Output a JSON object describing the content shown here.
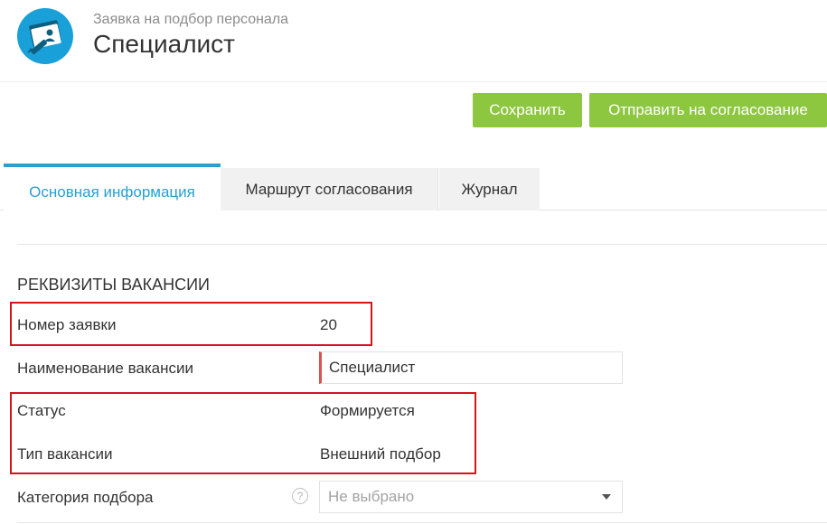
{
  "header": {
    "subtitle": "Заявка на подбор персонала",
    "title": "Специалист",
    "icon": "recruiting-card-icon",
    "icon_color": "#1aa0d8"
  },
  "toolbar": {
    "save_label": "Сохранить",
    "send_label": "Отправить на согласование",
    "button_color": "#8dc63f"
  },
  "tabs": [
    {
      "label": "Основная информация",
      "active": true
    },
    {
      "label": "Маршрут согласования",
      "active": false
    },
    {
      "label": "Журнал",
      "active": false
    }
  ],
  "section": {
    "title": "РЕКВИЗИТЫ ВАКАНСИИ"
  },
  "fields": {
    "request_number": {
      "label": "Номер заявки",
      "value": "20"
    },
    "vacancy_name": {
      "label": "Наименование вакансии",
      "value": "Специалист"
    },
    "status": {
      "label": "Статус",
      "value": "Формируется"
    },
    "vacancy_type": {
      "label": "Тип вакансии",
      "value": "Внешний подбор"
    },
    "selection_category": {
      "label": "Категория подбора",
      "value": "Не выбрано",
      "help": "?"
    }
  },
  "accent_color": "#2a9fd0",
  "highlight_color": "#d4141e"
}
